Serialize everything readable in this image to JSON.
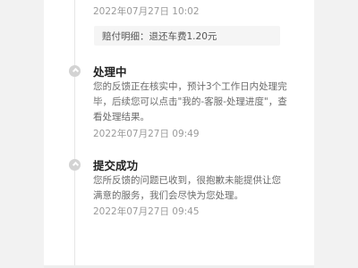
{
  "events": [
    {
      "time": "2022年07月27日 10:02",
      "detail": "赔付明细：退还车费1.20元"
    },
    {
      "title": "处理中",
      "desc": "您的反馈正在核实中，预计3个工作日内处理完毕，后续您可以点击\"我的-客服-处理进度\"，查看处理结果。",
      "time": "2022年07月27日 09:49"
    },
    {
      "title": "提交成功",
      "desc": "您所反馈的问题已收到，很抱歉未能提供让您满意的服务，我们会尽快为您处理。",
      "time": "2022年07月27日 09:45"
    }
  ]
}
